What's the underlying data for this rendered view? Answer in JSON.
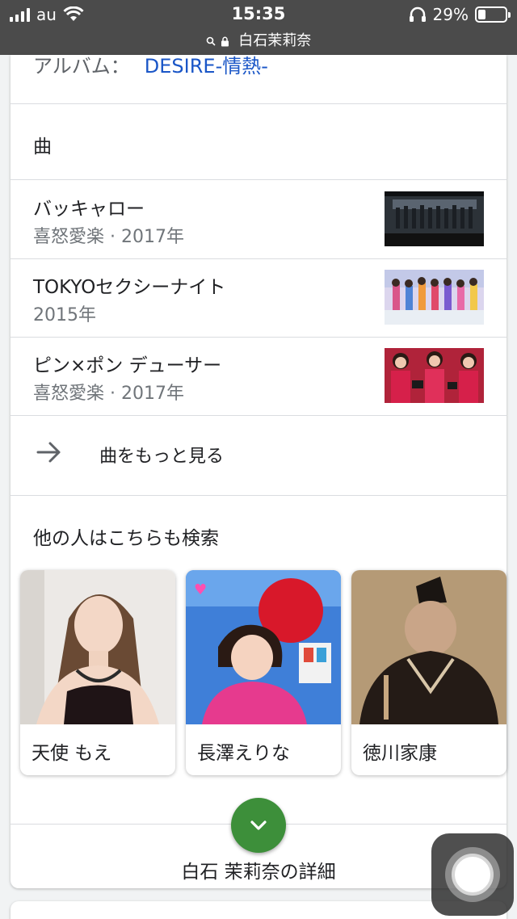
{
  "status_bar": {
    "carrier": "au",
    "time": "15:35",
    "battery": "29%",
    "battery_level": 0.29,
    "url": "白石茉莉奈"
  },
  "album": {
    "label": "アルバム：",
    "value": "DESIRE-情熱-"
  },
  "songs_section": {
    "title": "曲",
    "items": [
      {
        "title": "バッキャロー",
        "subtitle": "喜怒愛楽 · 2017年"
      },
      {
        "title": "TOKYOセクシーナイト",
        "subtitle": "2015年"
      },
      {
        "title": "ピン×ポン デューサー",
        "subtitle": "喜怒愛楽 · 2017年"
      }
    ],
    "more_label": "曲をもっと見る"
  },
  "related_section": {
    "title": "他の人はこちらも検索",
    "items": [
      {
        "name": "天使 もえ"
      },
      {
        "name": "長澤えりな"
      },
      {
        "name": "徳川家康"
      }
    ]
  },
  "details": {
    "label": "白石 茉莉奈の詳細"
  },
  "colors": {
    "status_bar": "#4b4b4b",
    "link": "#1a56c7",
    "expand_button": "#3d8f3a",
    "divider": "#dadce0"
  }
}
